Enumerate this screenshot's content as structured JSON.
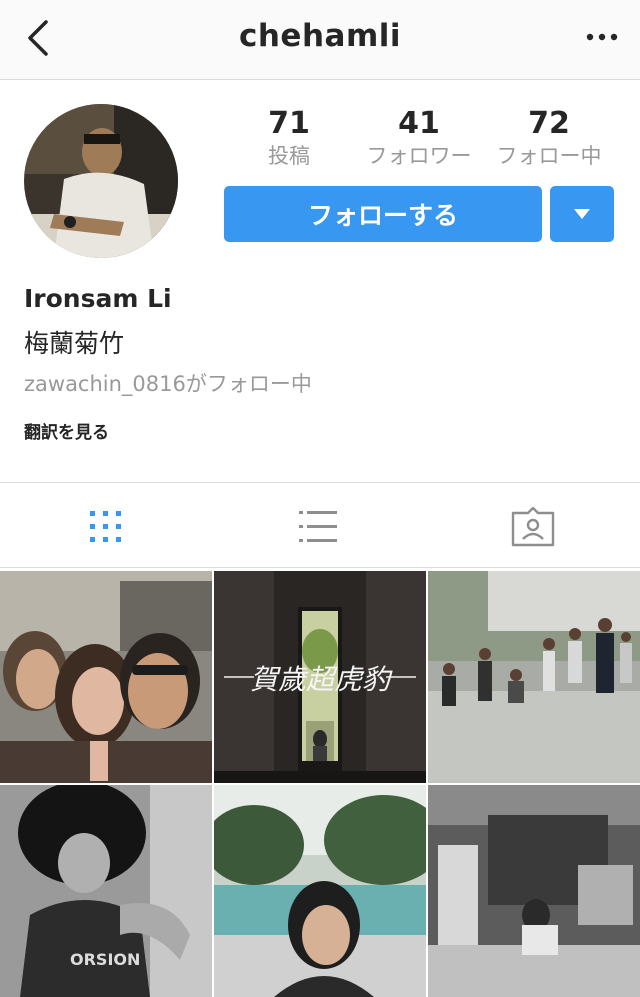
{
  "header": {
    "title": "chehamli",
    "back_icon": "chevron-left-icon",
    "more_icon": "more-horizontal-icon"
  },
  "stats": [
    {
      "value": "71",
      "label": "投稿"
    },
    {
      "value": "41",
      "label": "フォロワー"
    },
    {
      "value": "72",
      "label": "フォロー中"
    }
  ],
  "actions": {
    "follow_label": "フォローする",
    "dropdown_icon": "caret-down-icon",
    "accent": "#3897f0"
  },
  "profile": {
    "name": "Ironsam Li",
    "bio": "梅蘭菊竹",
    "followed_by": "zawachin_0816がフォロー中",
    "translate": "翻訳を見る"
  },
  "tabs": [
    {
      "icon": "grid-icon",
      "active": true
    },
    {
      "icon": "list-icon",
      "active": false
    },
    {
      "icon": "tagged-icon",
      "active": false
    }
  ],
  "grid": {
    "photo3_text": "賀歲超虎豹"
  }
}
